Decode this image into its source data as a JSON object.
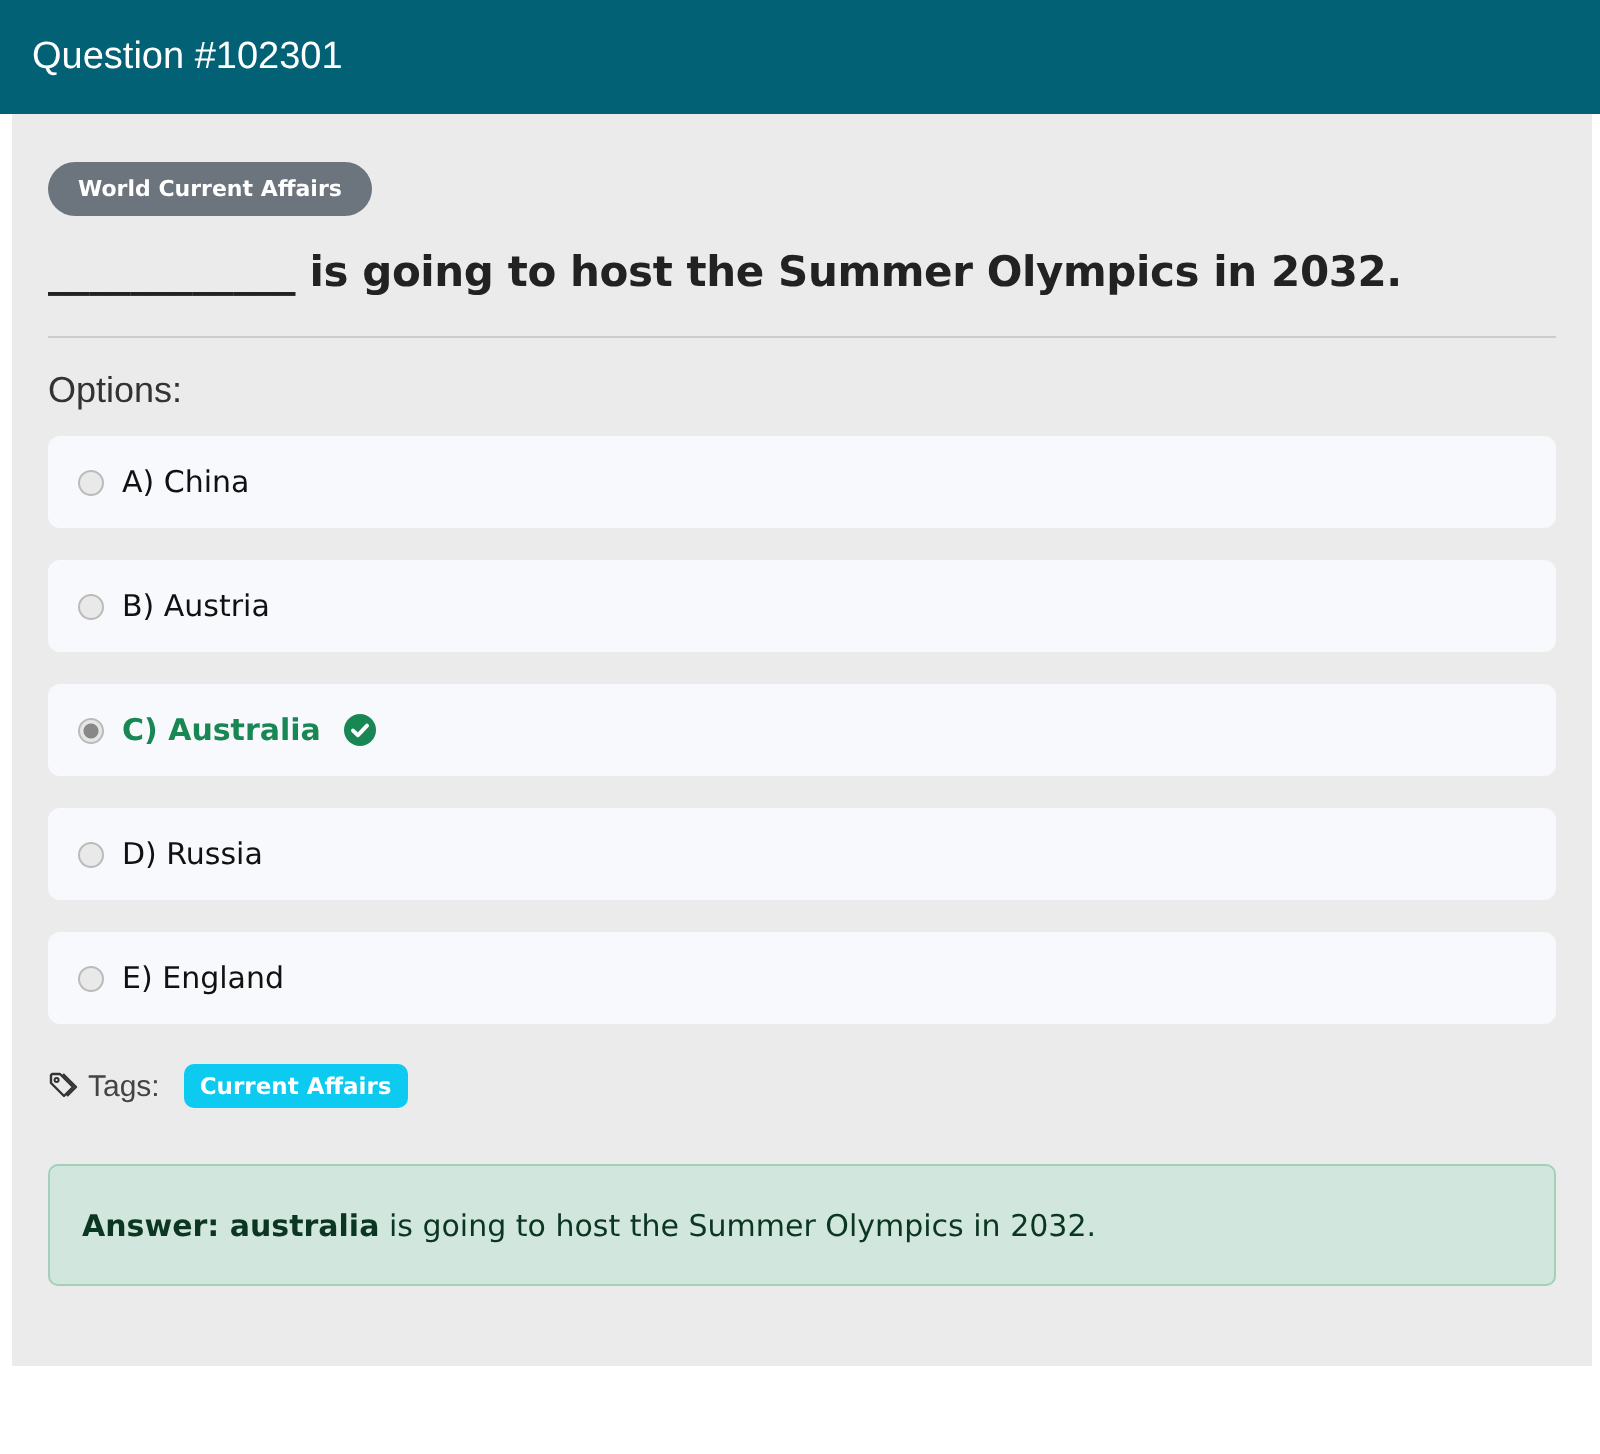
{
  "header": {
    "title": "Question #102301"
  },
  "category": "World Current Affairs",
  "question": "____________ is going to host the Summer Olympics in 2032.",
  "options_label": "Options:",
  "options": [
    {
      "label": "A) China",
      "selected": false,
      "correct": false
    },
    {
      "label": "B) Austria",
      "selected": false,
      "correct": false
    },
    {
      "label": "C) Australia",
      "selected": true,
      "correct": true
    },
    {
      "label": "D) Russia",
      "selected": false,
      "correct": false
    },
    {
      "label": "E) England",
      "selected": false,
      "correct": false
    }
  ],
  "tags_label": "Tags:",
  "tags": [
    "Current Affairs"
  ],
  "answer": "**Answer: australia** is going to host the Summer Olympics in 2032."
}
